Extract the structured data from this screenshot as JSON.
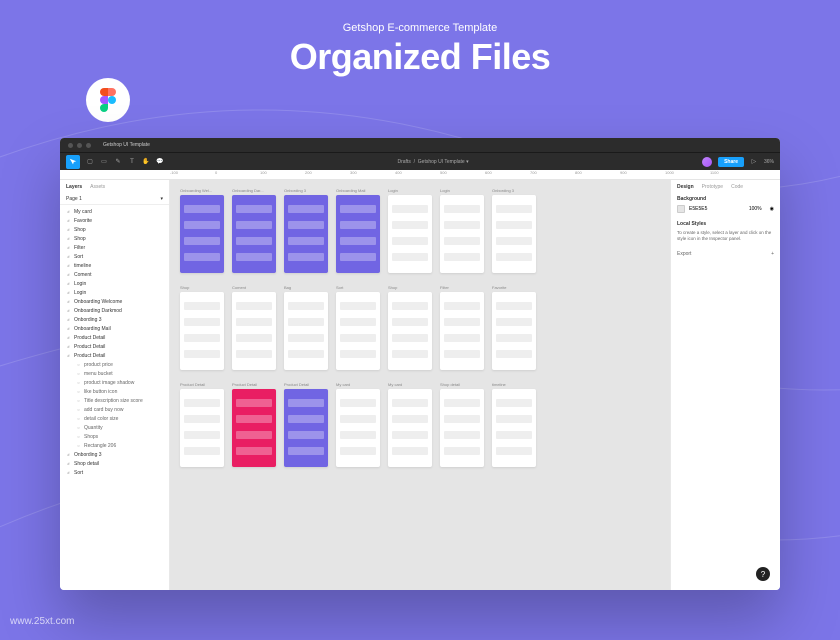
{
  "hero": {
    "subtitle": "Getshop E-commerce Template",
    "title": "Organized Files"
  },
  "titlebar": {
    "tab": "Getshop UI Template"
  },
  "toolbar": {
    "breadcrumb_left": "Drafts",
    "breadcrumb_right": "Getshop UI Template",
    "share": "Share",
    "zoom": "36%"
  },
  "ruler": [
    "-100",
    "0",
    "100",
    "200",
    "300",
    "400",
    "500",
    "600",
    "700",
    "800",
    "900",
    "1000",
    "1100"
  ],
  "leftPanel": {
    "tabs": {
      "layers": "Layers",
      "assets": "Assets"
    },
    "page": "Page 1",
    "layers": [
      {
        "icon": "#",
        "t": "My card"
      },
      {
        "icon": "#",
        "t": "Favorite"
      },
      {
        "icon": "#",
        "t": "Shop"
      },
      {
        "icon": "#",
        "t": "Shop"
      },
      {
        "icon": "#",
        "t": "Filter"
      },
      {
        "icon": "#",
        "t": "Sort"
      },
      {
        "icon": "#",
        "t": "timeline"
      },
      {
        "icon": "#",
        "t": "Coment"
      },
      {
        "icon": "#",
        "t": "Login"
      },
      {
        "icon": "#",
        "t": "Login"
      },
      {
        "icon": "#",
        "t": "Onboarding Welcome"
      },
      {
        "icon": "#",
        "t": "Onboarding Darkmod"
      },
      {
        "icon": "#",
        "t": "Onbording 3"
      },
      {
        "icon": "#",
        "t": "Onboarding Mail"
      },
      {
        "icon": "#",
        "t": "Product Detail"
      },
      {
        "icon": "#",
        "t": "Product Detail"
      },
      {
        "icon": "#",
        "t": "Product Detail"
      }
    ],
    "children": [
      {
        "t": "product price"
      },
      {
        "t": "menu bucket"
      },
      {
        "t": "product image shadow"
      },
      {
        "t": "like button icon"
      },
      {
        "t": "Title description size score"
      },
      {
        "t": "add card buy now"
      },
      {
        "t": "detail color size"
      },
      {
        "t": "Quantity"
      },
      {
        "t": "Shops"
      },
      {
        "t": "Rectangle 206"
      }
    ],
    "tail": [
      {
        "icon": "#",
        "t": "Onbording 3"
      },
      {
        "icon": "#",
        "t": "Shop detail"
      },
      {
        "icon": "#",
        "t": "Sort"
      }
    ]
  },
  "canvas": {
    "row1": [
      "Onboarding Wel...",
      "Onboarding Dar...",
      "Onbording 3",
      "Onboarding Mail",
      "Login",
      "Login",
      "Onbording 3"
    ],
    "row2": [
      "Shop",
      "Coment",
      "Bag",
      "Sort",
      "Shop",
      "Filter",
      "Favorite"
    ],
    "row3": [
      "Product Detail",
      "Product Detail",
      "Product Detail",
      "My card",
      "My card",
      "Shop detail",
      "timeline"
    ]
  },
  "rightPanel": {
    "tabs": {
      "design": "Design",
      "prototype": "Prototype",
      "code": "Code"
    },
    "bg": {
      "label": "Background",
      "value": "E5E5E5",
      "opacity": "100%"
    },
    "styles": {
      "label": "Local Styles",
      "hint": "To create a style, select a layer and click on the style icon in the Inspector panel."
    },
    "export": "Export"
  },
  "watermark": "www.25xt.com",
  "help": "?"
}
